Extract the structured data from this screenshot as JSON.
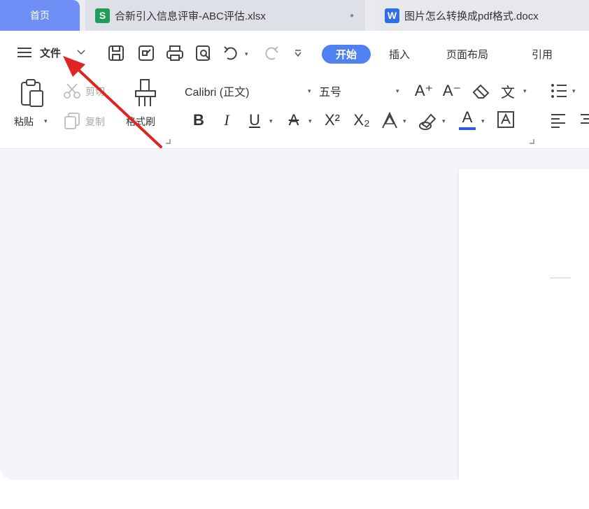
{
  "tabs": [
    {
      "label": "首页"
    },
    {
      "label": "合新引入信息评审-ABC评估.xlsx",
      "icon": "spreadsheet-icon",
      "icon_glyph": "S",
      "icon_color": "#1f9e5a"
    },
    {
      "label": "图片怎么转换成pdf格式.docx",
      "icon": "word-doc-icon",
      "icon_glyph": "W",
      "icon_color": "#2e6fe8"
    }
  ],
  "menu": {
    "file": "文件",
    "start": "开始",
    "insert": "插入",
    "page_layout": "页面布局",
    "reference": "引用"
  },
  "clipboard": {
    "paste": "粘贴",
    "cut": "剪切",
    "copy": "复制",
    "format_painter": "格式刷"
  },
  "font": {
    "name": "Calibri (正文)",
    "size": "五号",
    "bold": "B",
    "italic": "I",
    "underline": "U",
    "strikethrough": "A",
    "superscript": "X²",
    "subscript": "X₂",
    "grow": "A⁺",
    "shrink": "A⁻",
    "font_color": "A",
    "char_border": "A",
    "phonetic": "文"
  },
  "colors": {
    "accent": "#4f82f0",
    "home_tab": "#6f8ff7",
    "arrow": "#e02424",
    "font_color_bar": "#2e5bd8"
  }
}
